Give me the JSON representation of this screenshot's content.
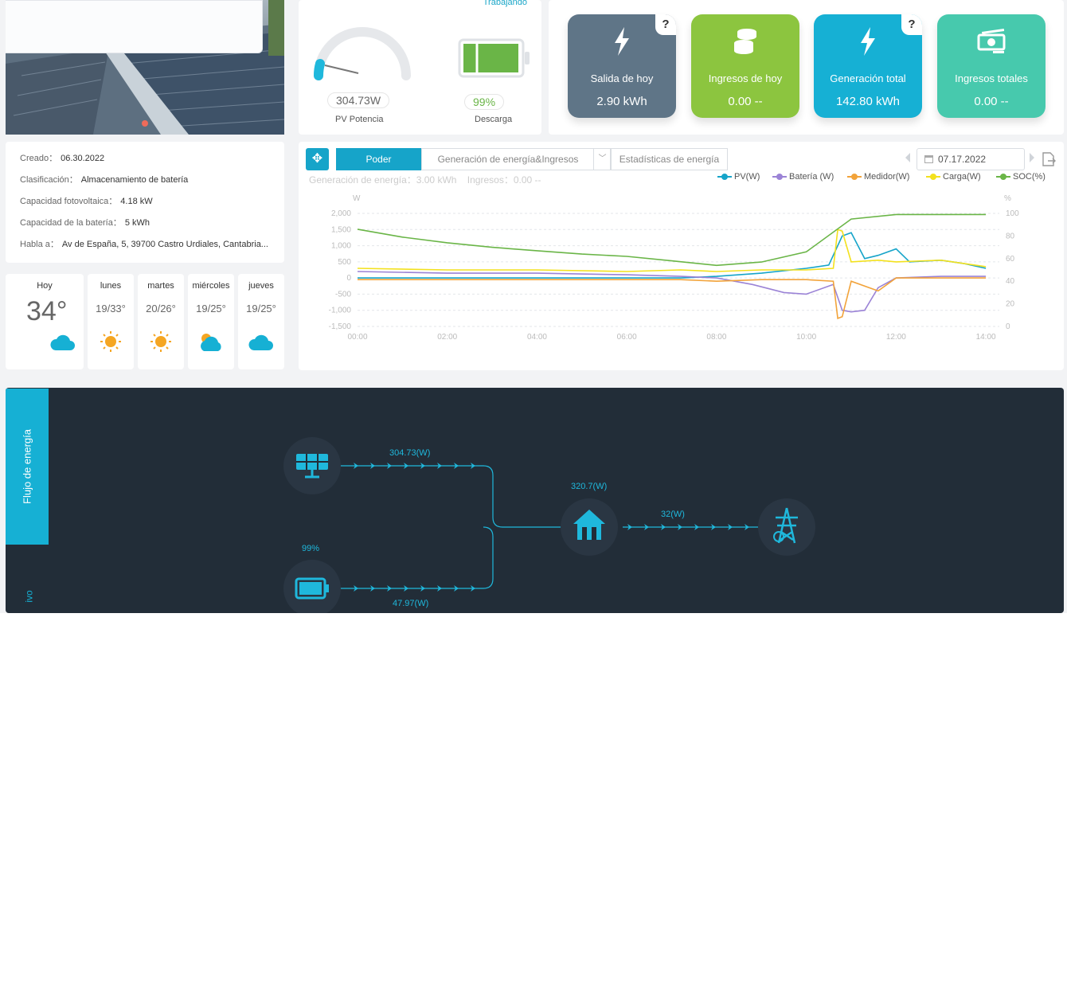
{
  "gauges": {
    "status": "Trabajando",
    "pv_value": "304.73W",
    "pv_caption": "PV Potencia",
    "battery_value": "99%",
    "battery_caption": "Descarga",
    "battery_level": 0.99
  },
  "kpis": [
    {
      "icon": "lightning-icon",
      "label": "Salida de hoy",
      "value": "2.90 kWh",
      "color": "#5f7587",
      "help": "?"
    },
    {
      "icon": "coins-icon",
      "label": "Ingresos de hoy",
      "value": "0.00 --",
      "color": "#8cc53f"
    },
    {
      "icon": "lightning-icon",
      "label": "Generación total",
      "value": "142.80 kWh",
      "color": "#16b0d4",
      "help": "?"
    },
    {
      "icon": "money-icon",
      "label": "Ingresos totales",
      "value": "0.00 --",
      "color": "#47c9ad"
    }
  ],
  "info": {
    "created_label": "Creado：",
    "created": "06.30.2022",
    "class_label": "Clasificación：",
    "class": "Almacenamiento de batería",
    "pv_cap_label": "Capacidad fotovoltaica：",
    "pv_cap": "4.18 kW",
    "bat_cap_label": "Capacidad de la batería：",
    "bat_cap": "5 kWh",
    "addr_label": "Habla a：",
    "addr": "Av de España, 5, 39700 Castro Urdiales, Cantabria..."
  },
  "weather": [
    {
      "day": "Hoy",
      "temp": "34°",
      "icon": "cloud-icon"
    },
    {
      "day": "lunes",
      "range": "19/33°",
      "icon": "sun-icon"
    },
    {
      "day": "martes",
      "range": "20/26°",
      "icon": "sun-icon"
    },
    {
      "day": "miércoles",
      "range": "19/25°",
      "icon": "sun-cloud-icon"
    },
    {
      "day": "jueves",
      "range": "19/25°",
      "icon": "cloud-icon"
    }
  ],
  "chart": {
    "tabs": [
      "Poder",
      "Generación de energía&Ingresos",
      "Estadísticas de energía"
    ],
    "date": "07.17.2022",
    "summary_gen": "Generación de energía：3.00 kWh",
    "summary_income": "Ingresos：0.00 --",
    "legend": [
      {
        "name": "PV(W)",
        "color": "#16a4c9"
      },
      {
        "name": "Batería (W)",
        "color": "#9b83d6"
      },
      {
        "name": "Medidor(W)",
        "color": "#f2a33a"
      },
      {
        "name": "Carga(W)",
        "color": "#f3e11d"
      },
      {
        "name": "SOC(%)",
        "color": "#6ab547"
      }
    ]
  },
  "chart_data": {
    "type": "line",
    "yunit_left": "W",
    "yunit_right": "%",
    "ylim_left": [
      -1500,
      2000
    ],
    "ylim_right": [
      0,
      100
    ],
    "y_ticks_left": [
      "2,000",
      "1,500",
      "1,000",
      "500",
      "0",
      "-500",
      "-1,000",
      "-1,500"
    ],
    "y_ticks_right": [
      "100",
      "80",
      "60",
      "40",
      "20",
      "0"
    ],
    "x_ticks": [
      "00:00",
      "02:00",
      "04:00",
      "06:00",
      "08:00",
      "10:00",
      "12:00",
      "14:00"
    ],
    "grid": true,
    "legend_position": "top-right",
    "series": [
      {
        "name": "PV(W)",
        "axis": "left",
        "x": [
          0,
          2,
          4,
          6,
          7.2,
          8,
          9,
          10,
          10.5,
          10.8,
          11,
          11.3,
          11.6,
          12,
          12.3,
          13,
          13.5,
          14
        ],
        "y": [
          0,
          0,
          0,
          0,
          0,
          50,
          150,
          300,
          400,
          1300,
          1400,
          600,
          700,
          900,
          500,
          550,
          450,
          300
        ]
      },
      {
        "name": "Batería (W)",
        "axis": "left",
        "x": [
          0,
          2,
          4,
          6,
          7.2,
          8,
          8.8,
          9.5,
          10,
          10.6,
          10.8,
          11,
          11.3,
          11.6,
          12,
          13,
          14
        ],
        "y": [
          200,
          150,
          150,
          100,
          50,
          0,
          -200,
          -450,
          -500,
          -200,
          -1000,
          -1050,
          -1000,
          -300,
          0,
          50,
          50
        ]
      },
      {
        "name": "Medidor(W)",
        "axis": "left",
        "x": [
          0,
          2,
          4,
          6,
          7.2,
          8,
          9,
          10,
          10.6,
          10.7,
          10.8,
          11,
          11.6,
          12,
          13,
          14
        ],
        "y": [
          -50,
          -50,
          -50,
          -50,
          -50,
          -100,
          -50,
          -50,
          -100,
          -1250,
          -1200,
          -100,
          -400,
          0,
          0,
          0
        ]
      },
      {
        "name": "Carga(W)",
        "axis": "left",
        "x": [
          0,
          2,
          4,
          6,
          7.2,
          8,
          9,
          10,
          10.6,
          10.7,
          10.8,
          11,
          11.6,
          12,
          13,
          14
        ],
        "y": [
          300,
          250,
          250,
          200,
          250,
          200,
          250,
          250,
          300,
          1500,
          1450,
          500,
          550,
          500,
          550,
          350
        ]
      },
      {
        "name": "SOC(%)",
        "axis": "right",
        "x": [
          0,
          1,
          2,
          3,
          4,
          5,
          6,
          7,
          8,
          9,
          10,
          11,
          12,
          13,
          14
        ],
        "y": [
          86,
          79,
          74,
          70,
          67,
          64,
          62,
          58,
          54,
          57,
          66,
          95,
          99,
          99,
          99
        ]
      }
    ]
  },
  "flow": {
    "tab_label": "Flujo de energía",
    "tab2_label": "ivo",
    "pv_power": "304.73(W)",
    "battery_soc": "99%",
    "battery_power": "47.97(W)",
    "load_power": "320.7(W)",
    "grid_power": "32(W)",
    "line_color": "#1fb8dc"
  }
}
